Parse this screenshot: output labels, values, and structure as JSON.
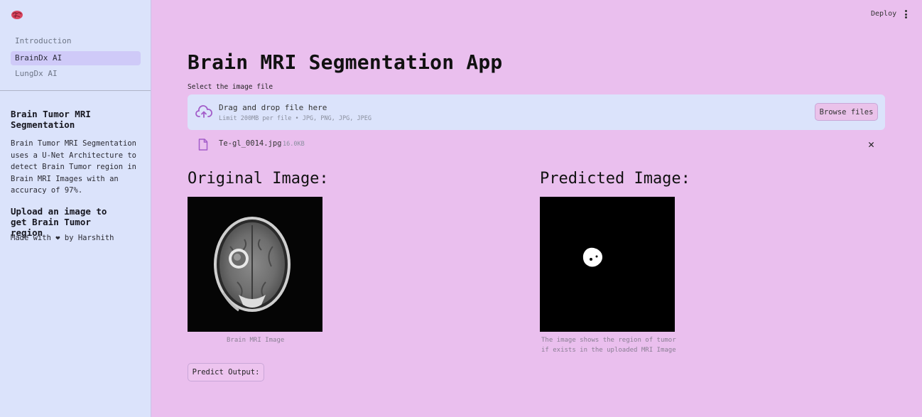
{
  "sidebar": {
    "logo_icon": "brain-icon",
    "nav": [
      {
        "label": "Introduction",
        "active": false
      },
      {
        "label": "BrainDx AI",
        "active": true
      },
      {
        "label": "LungDx AI",
        "active": false
      }
    ],
    "heading": "Brain Tumor MRI Segmentation",
    "description": "Brain Tumor MRI Segmentation uses a U-Net Architecture to detect Brain Tumor region in Brain MRI Images with an accuracy of 97%.",
    "upload_heading": "Upload an image to get Brain Tumor region",
    "made_with_prefix": "Made with",
    "made_with_heart": "❤",
    "made_with_suffix": "by Harshith"
  },
  "topbar": {
    "deploy_label": "Deploy",
    "menu_icon": "kebab-menu-icon"
  },
  "main": {
    "title": "Brain MRI Segmentation App",
    "uploader": {
      "label": "Select the image file",
      "drag_text": "Drag and drop file here",
      "limit_text": "Limit 200MB per file • JPG, PNG, JPG, JPEG",
      "browse_label": "Browse files",
      "icon": "cloud-upload-icon"
    },
    "uploaded_file": {
      "name": "Te-gl_0014.jpg",
      "size": "16.0KB",
      "icon": "file-icon",
      "remove_icon": "close-icon"
    },
    "original": {
      "heading": "Original Image:",
      "caption": "Brain MRI Image"
    },
    "predicted": {
      "heading": "Predicted Image:",
      "caption_line1": "The image shows the region of tumor",
      "caption_line2": "if exists in the uploaded MRI Image"
    },
    "predict_label": "Predict Output:"
  },
  "colors": {
    "main_bg": "#eabfee",
    "sidebar_bg": "#dbe3fb",
    "active_nav": "#cfcaf8",
    "accent": "#a35dc9"
  }
}
